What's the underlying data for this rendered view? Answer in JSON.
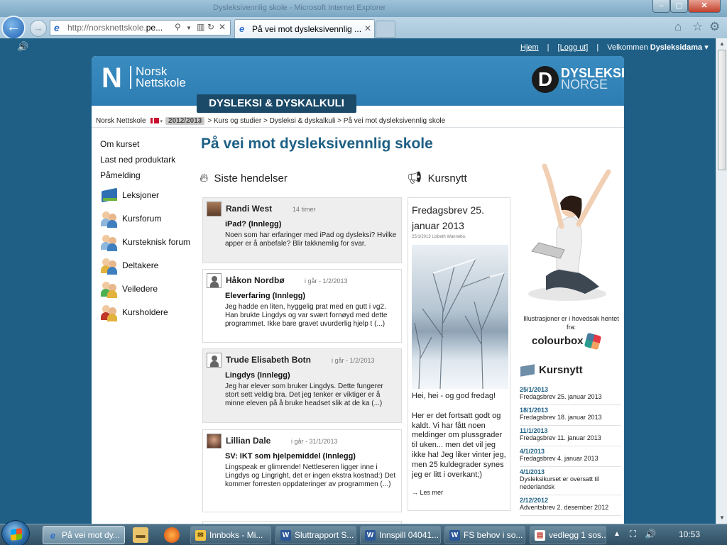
{
  "window": {
    "title": "Dysleksivennlig skole - Microsoft Internet Explorer"
  },
  "browser": {
    "url_prefix": "http://norsknettskole.",
    "url_host_part": "pe...",
    "tab_label": "På vei mot dysleksivennlig ...",
    "back_symbol": "←",
    "forward_symbol": "→"
  },
  "toplinks": {
    "home": "Hjem",
    "logout": "[Logg ut]",
    "welcome_prefix": "Velkommen ",
    "welcome_user": "Dysleksidama"
  },
  "site": {
    "logo_letter": "N",
    "logo_line1": "Norsk",
    "logo_line2": "Nettskole",
    "partner_letter": "D",
    "partner_line1": "DYSLEKSI",
    "partner_line2": "NORGE",
    "banner": "DYSLEKSI & DYSKALKULI"
  },
  "breadcrumb": {
    "root": "Norsk Nettskole",
    "year": "2012/2013",
    "path": "> Kurs og studier > Dysleksi & dyskalkuli > På vei mot dysleksivennlig skole"
  },
  "leftnav": {
    "plain": [
      "Om kurset",
      "Last ned produktark",
      "Påmelding"
    ],
    "icon_items": [
      "Leksjoner",
      "Kursforum",
      "Kursteknisk forum",
      "Deltakere",
      "Veiledere",
      "Kursholdere"
    ]
  },
  "page_title": "På vei mot dysleksivennlig skole",
  "sections": {
    "events": "Siste hendelser",
    "news": "Kursnytt"
  },
  "events": [
    {
      "name": "Randi West",
      "time": "14 timer",
      "subject": "iPad? (Innlegg)",
      "text": "Noen som har erfaringer med iPad og dysleksi? Hvilke apper er å anbefale? Blir takknemlig for svar."
    },
    {
      "name": "Håkon Nordbø",
      "time": "i går - 1/2/2013",
      "subject": "Eleverfaring (Innlegg)",
      "text": "Jeg hadde en liten, hyggelig prat med en gutt i vg2. Han brukte Lingdys og var svært fornøyd med dette programmet. Ikke bare gravet uvurderlig hjelp t (...)"
    },
    {
      "name": "Trude Elisabeth Botn",
      "time": "i går - 1/2/2013",
      "subject": "Lingdys (Innlegg)",
      "text": "Jeg har elever som bruker Lingdys. Dette fungerer stort sett veldig bra. Det jeg tenker er viktiger er å minne eleven på å bruke headset slik at de ka (...)"
    },
    {
      "name": "Lillian Dale",
      "time": "i går - 31/1/2013",
      "subject": "SV: IKT som hjelpemiddel (Innlegg)",
      "text": "Lingspeak er glimrende! Nettleseren ligger inne i Lingdys og Lingright, det er ingen ekstra kostnad:) Det kommer forresten oppdateringer av programmen (...)"
    }
  ],
  "news_card": {
    "title": "Fredagsbrev 25. januar 2013",
    "meta": "25/1/2013 Lisbeth Wannebo.",
    "greeting": "Hei, hei - og god fredag!",
    "body": "Her er det fortsatt godt og kaldt. Vi har fått noen meldinger om plussgrader til uken... men det vil jeg ikke ha! Jeg liker vinter jeg, men 25 kuldegrader synes jeg er litt i overkant;)",
    "more": "→ Les mer"
  },
  "sidebar": {
    "illustration_credit": "Illustrasjoner er i hovedsak hentet fra:",
    "credit_brand": "colourbox",
    "kursnytt_title": "Kursnytt",
    "news_list": [
      {
        "date": "25/1/2013",
        "title": "Fredagsbrev 25. januar 2013"
      },
      {
        "date": "18/1/2013",
        "title": "Fredagsbrev 18. januar 2013"
      },
      {
        "date": "11/1/2013",
        "title": "Fredagsbrev 11. januar 2013"
      },
      {
        "date": "4/1/2013",
        "title": "Fredagsbrev 4. januar 2013"
      },
      {
        "date": "4/1/2013",
        "title": "Dysleksikurset er oversatt til nederlandsk"
      },
      {
        "date": "2/12/2012",
        "title": "Adventsbrev 2. desember 2012"
      }
    ]
  },
  "taskbar": {
    "items": [
      "På vei mot dy...",
      "Innboks - Mi...",
      "Sluttrapport S...",
      "Innspill 04041...",
      "FS behov i so...",
      "vedlegg 1 sos..."
    ],
    "clock": "10:53"
  }
}
